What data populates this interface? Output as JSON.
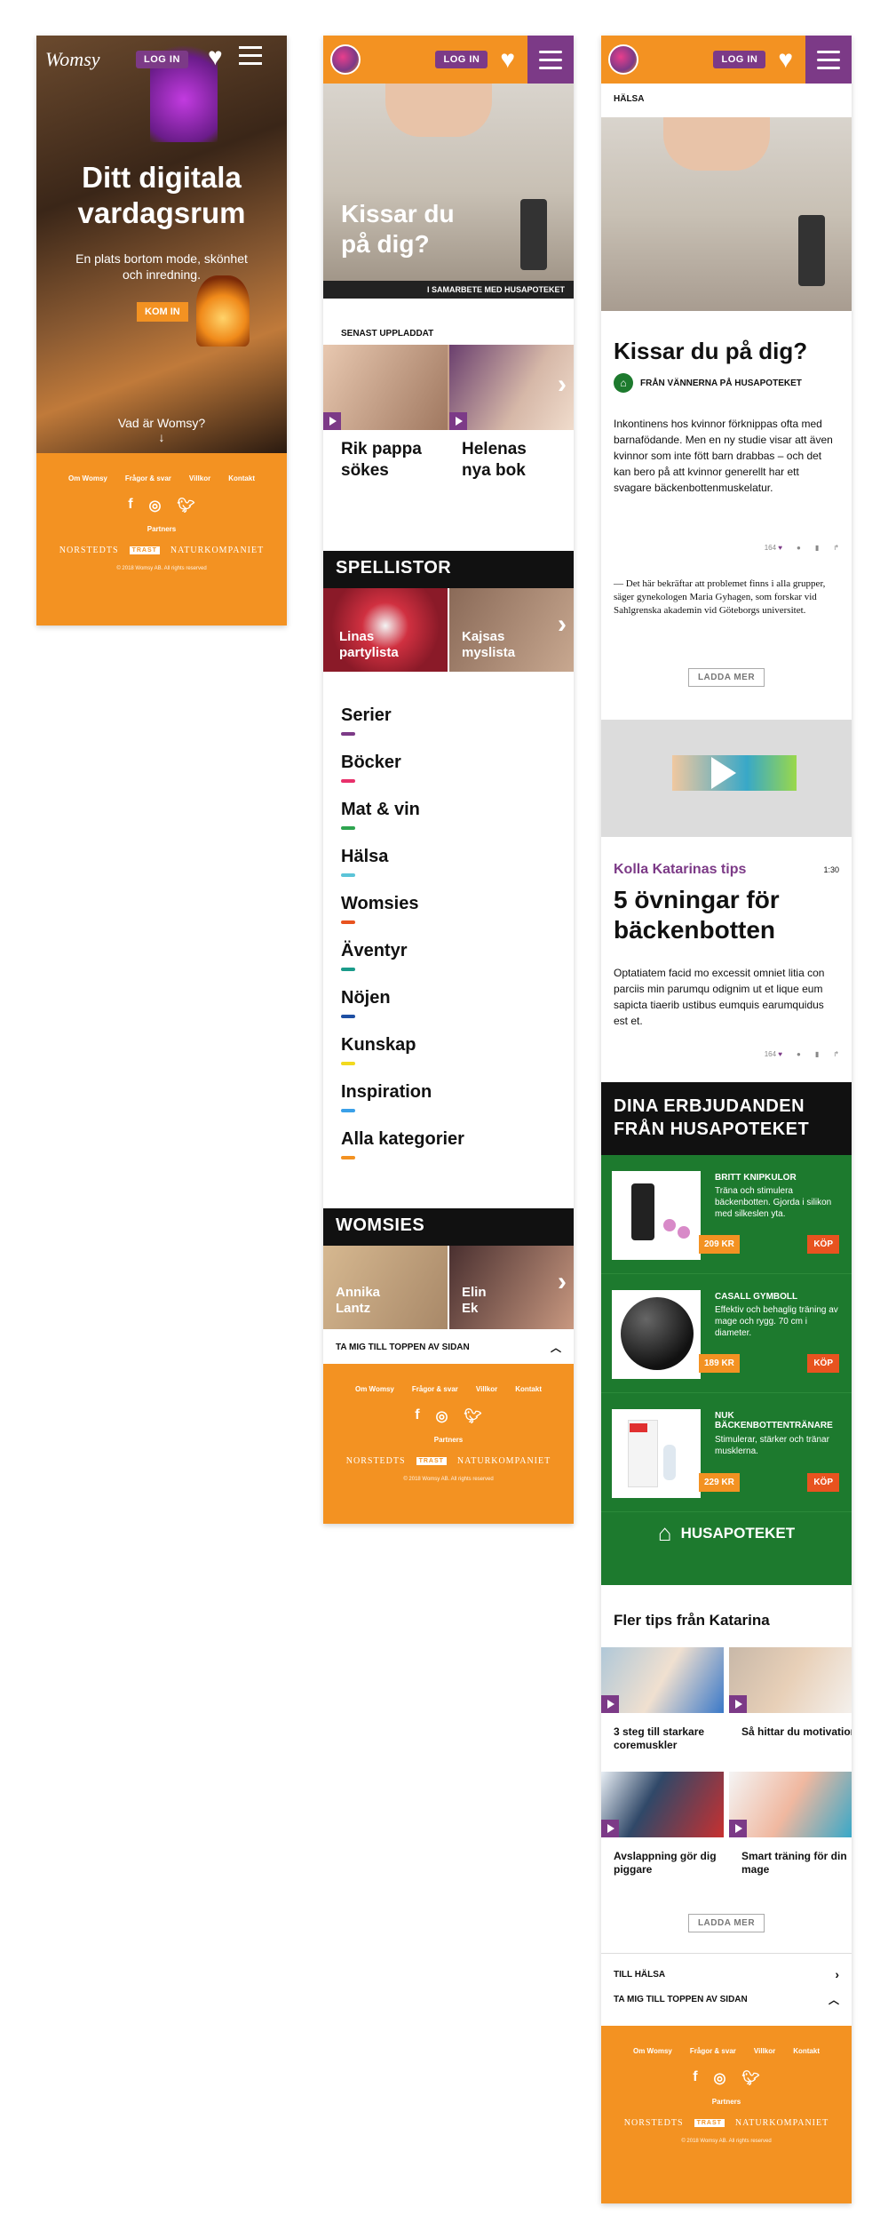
{
  "screen1": {
    "logo": "Womsy",
    "login": "LOG IN",
    "hero_title": "Ditt digitala vardagsrum",
    "hero_sub": "En plats bortom mode, skönhet och inredning.",
    "cta": "KOM IN",
    "what": "Vad är Womsy?"
  },
  "footer": {
    "links": [
      "Om Womsy",
      "Frågor & svar",
      "Villkor",
      "Kontakt"
    ],
    "partners": "Partners",
    "partner_logos": [
      "NORSTEDTS",
      "TRAST",
      "NATURKOMPANIET"
    ],
    "copyright": "© 2018 Womsy AB. All rights reserved"
  },
  "screen2": {
    "login": "LOG IN",
    "hero_title": "Kissar du på dig?",
    "hero_caption": "I SAMARBETE MED HUSAPOTEKET",
    "latest_label": "SENAST UPPLADDAT",
    "latest": [
      "Rik pappa sökes",
      "Helenas nya bok"
    ],
    "playlists_title": "SPELLISTOR",
    "playlists": [
      "Linas partylista",
      "Kajsas myslista"
    ],
    "categories": [
      {
        "label": "Serier",
        "color": "#7c3a87"
      },
      {
        "label": "Böcker",
        "color": "#e8316b"
      },
      {
        "label": "Mat & vin",
        "color": "#2ea44f"
      },
      {
        "label": "Hälsa",
        "color": "#5bc4d8"
      },
      {
        "label": "Womsies",
        "color": "#e8531f"
      },
      {
        "label": "Äventyr",
        "color": "#1a9b8a"
      },
      {
        "label": "Nöjen",
        "color": "#1e4fa3"
      },
      {
        "label": "Kunskap",
        "color": "#f2d91e"
      },
      {
        "label": "Inspiration",
        "color": "#3aa0e8"
      },
      {
        "label": "Alla kategorier",
        "color": "#f39222"
      }
    ],
    "womsies_title": "WOMSIES",
    "womsies": [
      "Annika Lantz",
      "Elin Ek"
    ],
    "to_top": "TA MIG TILL TOPPEN AV SIDAN"
  },
  "screen3": {
    "login": "LOG IN",
    "section": "HÄLSA",
    "title": "Kissar du på dig?",
    "from": "FRÅN VÄNNERNA PÅ HUSAPOTEKET",
    "intro": "Inkontinens hos kvinnor förknippas ofta med barnafödande. Men en ny studie visar att även kvinnor som inte fött barn drabbas – och det kan bero på att kvinnor generellt har ett svagare bäckenbottenmuskelatur.",
    "likes": "164",
    "quote": "— Det här bekräftar att problemet finns i alla grupper, säger gynekologen Maria Gyhagen, som forskar vid Sahlgrenska akademin vid Göteborgs universitet.",
    "load_more": "LADDA MER",
    "video_kicker": "Kolla Katarinas tips",
    "video_time": "1:30",
    "video_title": "5 övningar för bäckenbotten",
    "video_body": "Optatiatem facid mo excessit omniet litia con parciis min parumqu odignim ut et lique eum sapicta tiaerib ustibus eumquis earumquidus est et.",
    "offers_title": "DINA ERBJUDANDEN FRÅN HUSAPOTEKET",
    "products": [
      {
        "name": "BRITT KNIPKULOR",
        "desc": "Träna och stimulera bäckenbotten. Gjorda i silikon med silkeslen yta.",
        "price": "209 KR",
        "buy": "KÖP"
      },
      {
        "name": "CASALL GYMBOLL",
        "desc": "Effektiv och behaglig träning av mage och rygg. 70 cm i diameter.",
        "price": "189 KR",
        "buy": "KÖP"
      },
      {
        "name": "NUK BÄCKENBOTTENTRÄNARE",
        "desc": "Stimulerar, stärker och tränar musklerna.",
        "price": "229 KR",
        "buy": "KÖP"
      }
    ],
    "brand": "HUSAPOTEKET",
    "more_title": "Fler tips från Katarina",
    "more": [
      "3 steg till starkare coremuskler",
      "Så hittar du motivation",
      "Avslappning gör dig piggare",
      "Smart träning för din mage"
    ],
    "load_more2": "LADDA MER",
    "to_health": "TILL HÄLSA",
    "to_top": "TA MIG TILL TOPPEN AV SIDAN"
  },
  "colors": {
    "orange": "#f39222",
    "purple": "#7c3a87",
    "green": "#1d7a2e",
    "black": "#111111"
  }
}
